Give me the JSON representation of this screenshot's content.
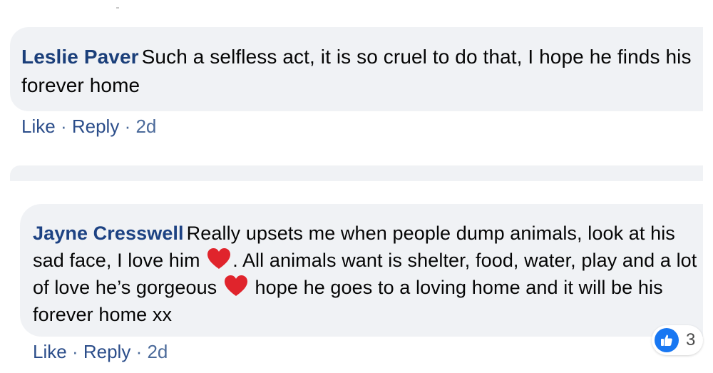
{
  "comments": [
    {
      "author": "Leslie Paver",
      "text": "Such a selfless act, it is so cruel to do that, I hope he finds his forever home",
      "actions": {
        "like": "Like",
        "sep": "·",
        "reply": "Reply",
        "time": "2d"
      }
    },
    {
      "author": "Jayne Cresswell",
      "text_part1": "Really upsets me when people dump animals, look at his sad face, I love him",
      "text_part2": ". All animals want is shelter, food, water, play and a lot of love he’s gorgeous",
      "text_part3": "hope he goes to a loving home and it will be his forever home xx",
      "actions": {
        "like": "Like",
        "sep": "·",
        "reply": "Reply",
        "time": "2d"
      },
      "reaction": {
        "icon": "thumbs-up-icon",
        "color": "#1877f2",
        "count": "3"
      }
    }
  ],
  "emoji": {
    "heart": "heart-icon",
    "heart_color": "#e0242c"
  },
  "colors": {
    "bubble": "#f0f2f5",
    "author": "#1b3f7a"
  }
}
